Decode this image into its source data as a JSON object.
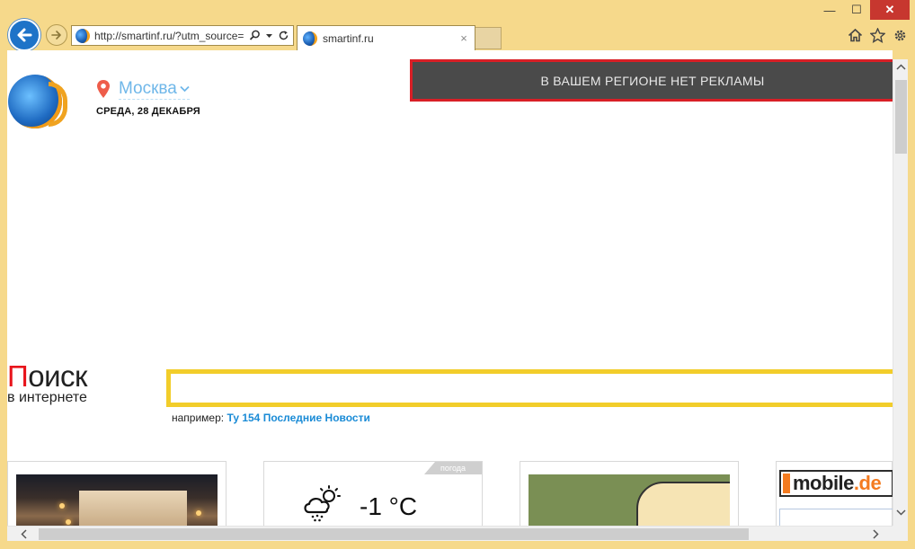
{
  "browser": {
    "address": "http://smartinf.ru/?utm_source=",
    "tab_title": "smartinf.ru",
    "tab_close": "×",
    "window": {
      "minimize": "—",
      "maximize": "☐",
      "close": "✕"
    }
  },
  "header": {
    "city": "Москва",
    "date": "СРЕДА, 28 ДЕКАБРЯ",
    "ad_banner": "В ВАШЕМ РЕГИОНЕ НЕТ РЕКЛАМЫ"
  },
  "search": {
    "logo_first": "П",
    "logo_rest": "оиск",
    "logo_sub": "в интернете",
    "input_value": "",
    "example_prefix": "например: ",
    "example_link": "Ту 154 Последние Новости"
  },
  "cards": {
    "weather_tag": "погода",
    "weather_temp": "-1 °C",
    "mobile_logo_main": "mobile",
    "mobile_logo_tld": ".de"
  },
  "colors": {
    "chrome": "#f6d98b",
    "accent_blue": "#1e73c8",
    "banner_border": "#d81f26",
    "search_border": "#f2cd2a",
    "link": "#1a8bd6"
  },
  "icons": [
    "back-arrow-icon",
    "forward-arrow-icon",
    "favicon-globe-icon",
    "search-icon",
    "dropdown-icon",
    "refresh-icon",
    "home-icon",
    "star-icon",
    "gear-icon",
    "location-pin-icon",
    "chevron-down-icon",
    "weather-snow-cloud-icon"
  ]
}
